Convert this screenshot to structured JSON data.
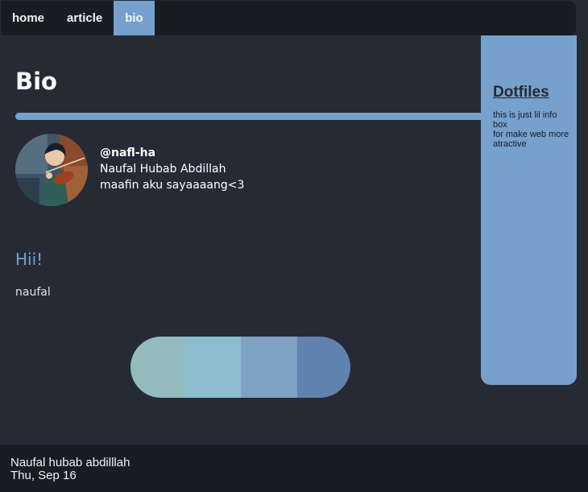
{
  "nav": {
    "items": [
      {
        "label": "home"
      },
      {
        "label": "article"
      },
      {
        "label": "bio",
        "active": true
      }
    ]
  },
  "main": {
    "title": "Bio",
    "profile": {
      "handle": "@nafl-ha",
      "name": "Naufal Hubab Abdillah",
      "bio": "maafin aku sayaaaang<3"
    },
    "greeting": "Hii!",
    "about": "naufal",
    "palette": [
      "#93bbbd",
      "#8abece",
      "#7ea2c4",
      "#5f82ae"
    ]
  },
  "sidebar": {
    "title": "Dotfiles",
    "text": "this is just lil info box\nfor make web more atractive"
  },
  "footer": {
    "name": "Naufal hubab abdilllah",
    "date": "Thu, Sep 16"
  },
  "colors": {
    "accent": "#75a1cc",
    "background": "#262a35",
    "bar_background": "#1a1c24"
  }
}
